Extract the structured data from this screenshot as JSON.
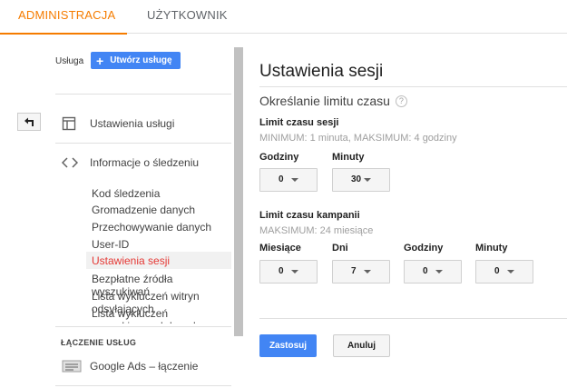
{
  "tabs": [
    {
      "label": "ADMINISTRACJA",
      "active": true
    },
    {
      "label": "UŻYTKOWNIK",
      "active": false
    }
  ],
  "sidebar": {
    "service_label": "Usługa",
    "create_button": "Utwórz usługę",
    "items": [
      {
        "label": "Ustawienia usługi",
        "icon": "window-icon"
      },
      {
        "label": "Informacje o śledzeniu",
        "icon": "code-brackets-icon"
      }
    ],
    "sub_items": [
      "Kod śledzenia",
      "Gromadzenie danych",
      "Przechowywanie danych",
      "User-ID",
      "Ustawienia sesji",
      "Bezpłatne źródła wyszukiwań",
      "Lista wykluczeń witryn odsyłających",
      "Lista wykluczeń wyszukiwanych haseł"
    ],
    "active_sub_item": "Ustawienia sesji",
    "section_heading": "ŁĄCZENIE USŁUG",
    "linking_item": "Google Ads – łączenie"
  },
  "panel": {
    "title": "Ustawienia sesji",
    "subtitle": "Określanie limitu czasu",
    "session": {
      "title": "Limit czasu sesji",
      "hint": "MINIMUM: 1 minuta, MAKSIMUM: 4 godziny",
      "hours_label": "Godziny",
      "hours_value": "0",
      "minutes_label": "Minuty",
      "minutes_value": "30"
    },
    "campaign": {
      "title": "Limit czasu kampanii",
      "hint": "MAKSIMUM: 24 miesiące",
      "months_label": "Miesiące",
      "months_value": "0",
      "days_label": "Dni",
      "days_value": "7",
      "hours_label": "Godziny",
      "hours_value": "0",
      "minutes_label": "Minuty",
      "minutes_value": "0"
    },
    "apply_button": "Zastosuj",
    "cancel_button": "Anuluj"
  },
  "colors": {
    "accent": "#f57c00",
    "primary": "#4285f4",
    "active_link": "#e53935"
  }
}
